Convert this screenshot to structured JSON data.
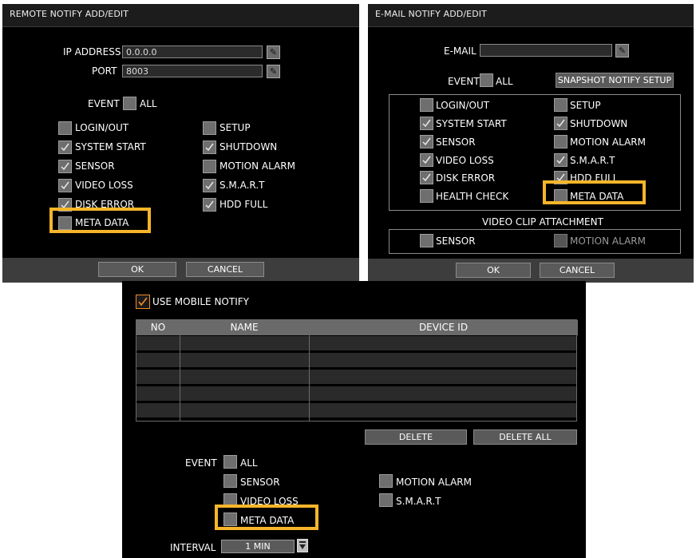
{
  "remote": {
    "title": "REMOTE NOTIFY ADD/EDIT",
    "ip_label": "IP ADDRESS",
    "ip_value": "0.0.0.0",
    "port_label": "PORT",
    "port_value": "8003",
    "event_label": "EVENT",
    "all_label": "ALL",
    "events": [
      {
        "label": "LOGIN/OUT",
        "checked": false
      },
      {
        "label": "SETUP",
        "checked": false
      },
      {
        "label": "SYSTEM START",
        "checked": true
      },
      {
        "label": "SHUTDOWN",
        "checked": true
      },
      {
        "label": "SENSOR",
        "checked": true
      },
      {
        "label": "MOTION ALARM",
        "checked": false
      },
      {
        "label": "VIDEO LOSS",
        "checked": true
      },
      {
        "label": "S.M.A.R.T",
        "checked": true
      },
      {
        "label": "DISK ERROR",
        "checked": true
      },
      {
        "label": "HDD FULL",
        "checked": true
      },
      {
        "label": "META DATA",
        "checked": false
      }
    ],
    "ok_label": "OK",
    "cancel_label": "CANCEL"
  },
  "email": {
    "title": "E-MAIL NOTIFY ADD/EDIT",
    "email_label": "E-MAIL",
    "email_value": "",
    "event_label": "EVENT",
    "all_label": "ALL",
    "snapshot_label": "SNAPSHOT NOTIFY SETUP",
    "events": [
      {
        "label": "LOGIN/OUT",
        "checked": false
      },
      {
        "label": "SETUP",
        "checked": false
      },
      {
        "label": "SYSTEM START",
        "checked": true
      },
      {
        "label": "SHUTDOWN",
        "checked": true
      },
      {
        "label": "SENSOR",
        "checked": true
      },
      {
        "label": "MOTION ALARM",
        "checked": false
      },
      {
        "label": "VIDEO LOSS",
        "checked": true
      },
      {
        "label": "S.M.A.R.T",
        "checked": true
      },
      {
        "label": "DISK ERROR",
        "checked": true
      },
      {
        "label": "HDD FULL",
        "checked": true
      },
      {
        "label": "HEALTH CHECK",
        "checked": false
      },
      {
        "label": "META DATA",
        "checked": false
      }
    ],
    "clip_title": "VIDEO CLIP ATTACHMENT",
    "clip_sensor": "SENSOR",
    "clip_motion": "MOTION ALARM",
    "ok_label": "OK",
    "cancel_label": "CANCEL"
  },
  "mobile": {
    "use_label": "USE MOBILE NOTIFY",
    "use_checked": true,
    "columns": [
      "NO",
      "NAME",
      "DEVICE ID"
    ],
    "rows": 5,
    "delete_label": "DELETE",
    "delete_all_label": "DELETE ALL",
    "event_label": "EVENT",
    "events": [
      {
        "label": "ALL",
        "checked": false
      },
      {
        "label": "SENSOR",
        "checked": false
      },
      {
        "label": "MOTION ALARM",
        "checked": false
      },
      {
        "label": "VIDEO LOSS",
        "checked": false
      },
      {
        "label": "S.M.A.R.T",
        "checked": false
      },
      {
        "label": "META DATA",
        "checked": false
      }
    ],
    "interval_label": "INTERVAL",
    "interval_value": "1 MIN"
  },
  "colors": {
    "highlight": "#f6b52a",
    "mobile_check": "#f28c28",
    "panel_bg": "#000000"
  }
}
